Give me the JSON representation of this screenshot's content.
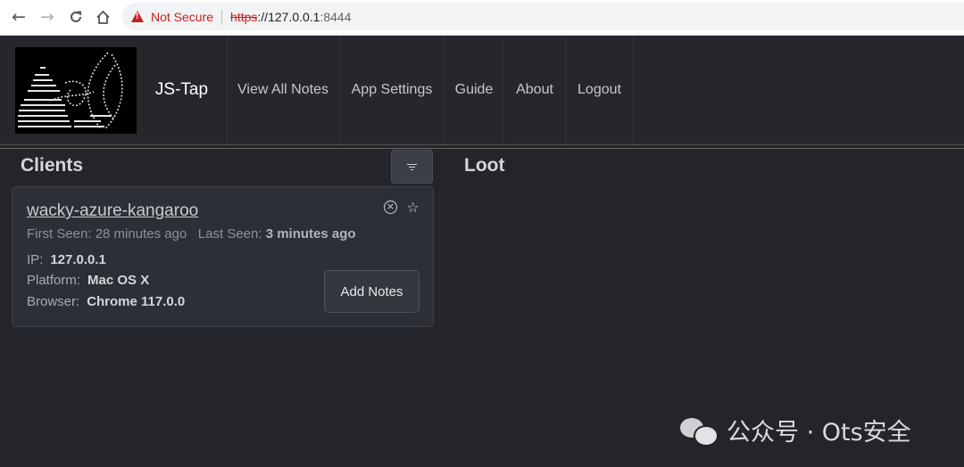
{
  "browser": {
    "security_label": "Not Secure",
    "url_scheme": "https",
    "url_rest": "://127.0.0.1",
    "url_port": ":8444"
  },
  "header": {
    "brand": "JS-Tap",
    "nav": [
      "View All Notes",
      "App Settings",
      "Guide",
      "About",
      "Logout"
    ]
  },
  "clients": {
    "title": "Clients",
    "items": [
      {
        "name": "wacky-azure-kangaroo",
        "first_seen_label": "First Seen:",
        "first_seen_value": "28 minutes ago",
        "last_seen_label": "Last Seen:",
        "last_seen_value": "3 minutes ago",
        "ip_label": "IP:",
        "ip": "127.0.0.1",
        "platform_label": "Platform:",
        "platform": "Mac OS X",
        "browser_label": "Browser:",
        "browser": "Chrome 117.0.0",
        "button": "Add Notes"
      }
    ]
  },
  "loot": {
    "title": "Loot"
  },
  "watermark": {
    "text": "公众号 · Ots安全"
  },
  "colors": {
    "background": "#23252b",
    "card": "#2c2f35",
    "warning_red": "#c5221f"
  }
}
